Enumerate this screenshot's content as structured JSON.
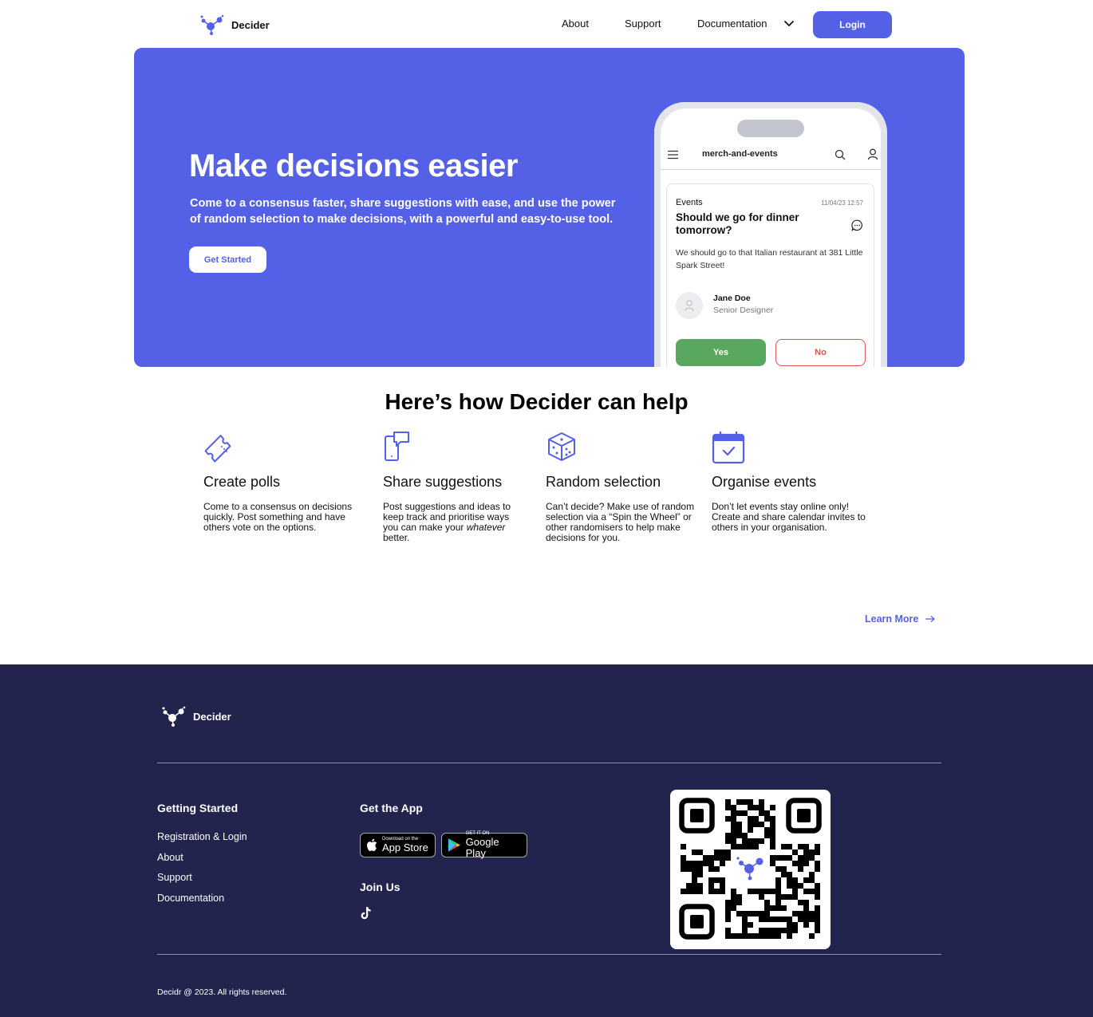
{
  "nav": {
    "brand": "Decider",
    "links": [
      "About",
      "Support",
      "Documentation"
    ],
    "login_label": "Login"
  },
  "hero": {
    "title": "Make decisions easier",
    "subtitle": "Come to a consensus faster, share suggestions with ease, and use the power of random selection to make decisions, with a powerful and easy-to-use tool.",
    "cta_label": "Get Started"
  },
  "phone": {
    "app_title": "merch-and-events",
    "card": {
      "category": "Events",
      "date": "11/04/23 12:57",
      "title": "Should we go for dinner tomorrow?",
      "body": "We should go to that Italian restaurant at 381 Little Spark Street!",
      "person_name": "Jane Doe",
      "person_role": "Senior Designer",
      "yes_label": "Yes",
      "no_label": "No"
    }
  },
  "features": {
    "title": "Here’s how Decider can help",
    "items": [
      {
        "icon": "ticket-icon",
        "title": "Create polls",
        "text": "Come to a consensus on decisions quickly. Post something and have others vote on the options."
      },
      {
        "icon": "share-note-icon",
        "title": "Share suggestions",
        "text_before": "Post suggestions and ideas to keep track and prioritise ways you can make your ",
        "text_em": "whatever",
        "text_after": " better."
      },
      {
        "icon": "dice-icon",
        "title": "Random selection",
        "text": "Can’t decide? Make use of random selection via a “Spin the Wheel” or other randomisers to help make decisions for you."
      },
      {
        "icon": "calendar-check-icon",
        "title": "Organise events",
        "text": "Don’t let events stay online only! Create and share calendar invites to others in your organisation."
      }
    ],
    "learn_more": "Learn More"
  },
  "footer": {
    "brand": "Decider",
    "getting_started": {
      "heading": "Getting Started",
      "links": [
        "Registration & Login",
        "About",
        "Support",
        "Documentation"
      ]
    },
    "get_app": {
      "heading": "Get the App",
      "app_store_small": "Download on the",
      "app_store_big": "App Store",
      "google_small": "GET IT ON",
      "google_big": "Google Play"
    },
    "join": {
      "heading": "Join Us",
      "social_icon": "tiktok-icon"
    },
    "copyright": "Decidr @ 2023. All rights reserved."
  },
  "colors": {
    "accent": "#5461e6",
    "footer_bg": "#23244d",
    "yes": "#5aa75f",
    "no": "#d9534f"
  }
}
